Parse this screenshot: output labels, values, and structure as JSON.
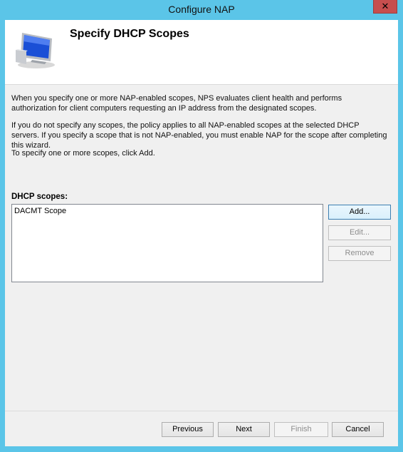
{
  "window": {
    "title": "Configure NAP",
    "close_glyph": "✕"
  },
  "header": {
    "title": "Specify DHCP Scopes",
    "icon": "computer-monitor-icon"
  },
  "description": {
    "p1": "When you specify one or more NAP-enabled scopes, NPS evaluates client health and performs authorization for client computers requesting an IP address from the designated scopes.",
    "p2": "If you do not specify any scopes, the policy applies to all NAP-enabled scopes at the selected DHCP servers. If you specify a scope that is not NAP-enabled, you must enable NAP for the scope after completing this wizard.",
    "p3": "To specify one or more scopes, click Add."
  },
  "scopes": {
    "label": "DHCP scopes:",
    "items": [
      "DACMT Scope"
    ],
    "add_label": "Add...",
    "edit_label": "Edit...",
    "remove_label": "Remove"
  },
  "footer": {
    "previous_label": "Previous",
    "next_label": "Next",
    "finish_label": "Finish",
    "cancel_label": "Cancel"
  },
  "colors": {
    "title_bar": "#5bc5e8",
    "close_button": "#c74e4e",
    "dialog_bg": "#f0f0f0"
  }
}
